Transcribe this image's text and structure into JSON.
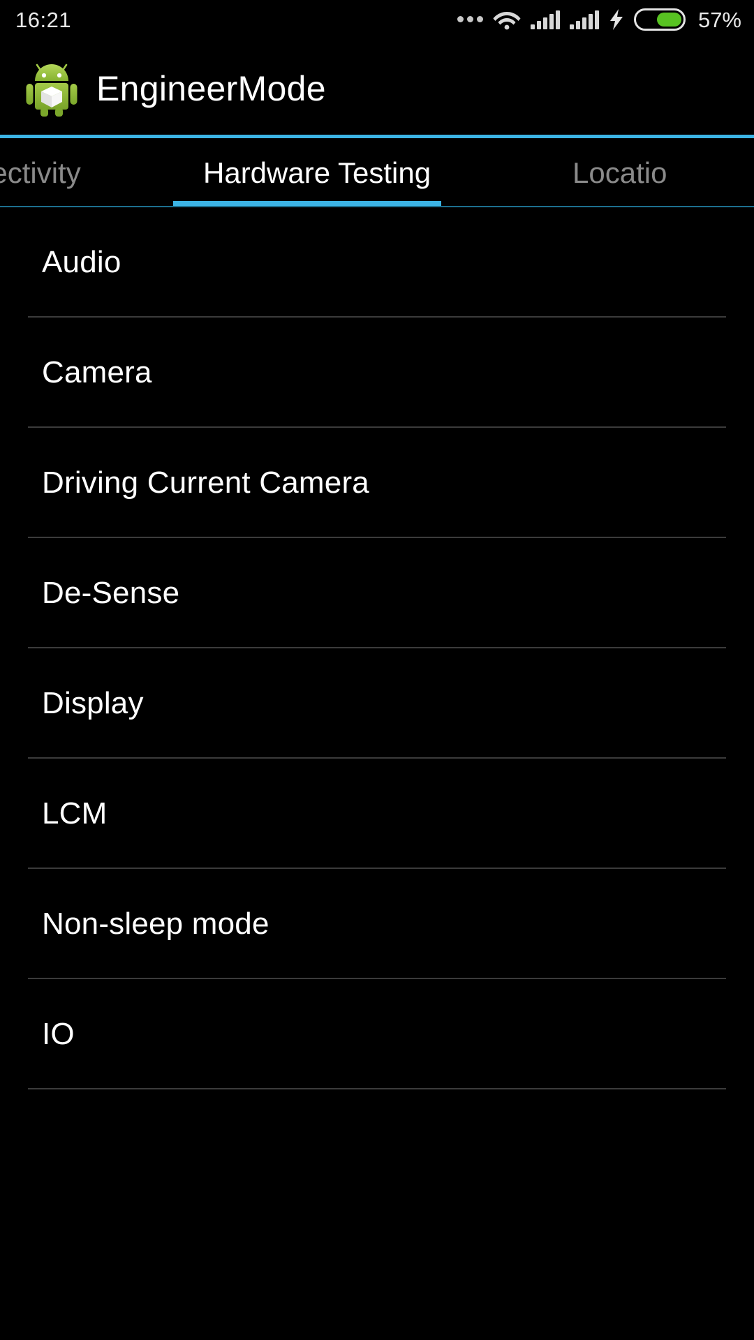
{
  "statusbar": {
    "time": "16:21",
    "battery_percent_label": "57%",
    "battery_level": 57,
    "icons": [
      "more-dots-icon",
      "wifi-icon",
      "signal-icon",
      "signal-icon",
      "charging-bolt-icon",
      "battery-icon"
    ],
    "colors": {
      "battery_fill": "#58c322",
      "text": "#e9e9e9"
    }
  },
  "appbar": {
    "title": "EngineerMode",
    "icon": "android-robot-icon",
    "accent_color": "#3cb4e5"
  },
  "tabs": {
    "items": [
      {
        "label": "nectivity",
        "full_label": "Connectivity",
        "active": false
      },
      {
        "label": "Hardware Testing",
        "active": true
      },
      {
        "label": "Locatio",
        "full_label": "Location",
        "active": false
      }
    ],
    "active_index": 1,
    "indicator_color": "#3cb4e5"
  },
  "list": {
    "items": [
      {
        "label": "Audio"
      },
      {
        "label": "Camera"
      },
      {
        "label": "Driving Current Camera"
      },
      {
        "label": "De-Sense"
      },
      {
        "label": "Display"
      },
      {
        "label": "LCM"
      },
      {
        "label": "Non-sleep mode"
      },
      {
        "label": "IO"
      }
    ]
  }
}
